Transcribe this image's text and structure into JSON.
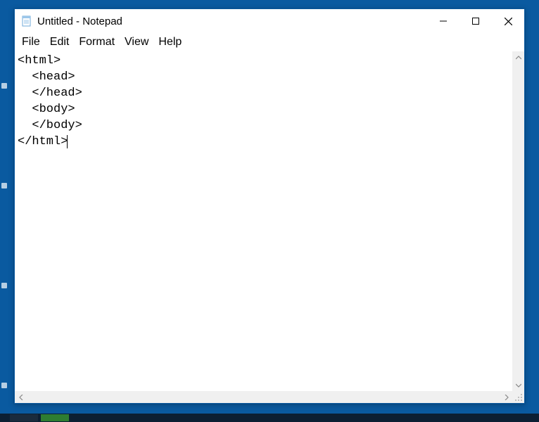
{
  "window": {
    "title": "Untitled - Notepad"
  },
  "menu": {
    "file": "File",
    "edit": "Edit",
    "format": "Format",
    "view": "View",
    "help": "Help"
  },
  "editor": {
    "lines": [
      "<html>",
      "  <head>",
      "  </head>",
      "  <body>",
      "",
      "  </body>",
      "</html>"
    ]
  },
  "icons": {
    "app": "notepad-icon",
    "minimize": "minimize-icon",
    "maximize": "maximize-icon",
    "close": "close-icon",
    "scroll_up": "chevron-up-icon",
    "scroll_down": "chevron-down-icon",
    "scroll_left": "chevron-left-icon",
    "scroll_right": "chevron-right-icon"
  }
}
